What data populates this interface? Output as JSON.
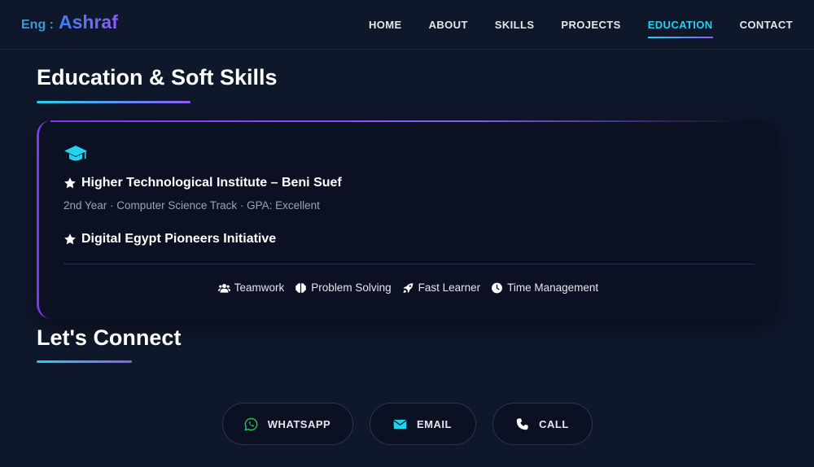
{
  "header": {
    "logo_prefix": "Eng :",
    "logo_name": "Ashraf",
    "nav": [
      {
        "label": "HOME",
        "active": false
      },
      {
        "label": "ABOUT",
        "active": false
      },
      {
        "label": "SKILLS",
        "active": false
      },
      {
        "label": "PROJECTS",
        "active": false
      },
      {
        "label": "EDUCATION",
        "active": true
      },
      {
        "label": "CONTACT",
        "active": false
      }
    ]
  },
  "education": {
    "title": "Education & Soft Skills",
    "items": [
      {
        "name": "Higher Technological Institute – Beni Suef",
        "detail": "2nd Year · Computer Science Track · GPA: Excellent"
      },
      {
        "name": "Digital Egypt Pioneers Initiative"
      }
    ],
    "soft_skills": [
      {
        "label": "Teamwork",
        "icon": "users-icon"
      },
      {
        "label": "Problem Solving",
        "icon": "brain-icon"
      },
      {
        "label": "Fast Learner",
        "icon": "rocket-icon"
      },
      {
        "label": "Time Management",
        "icon": "clock-icon"
      }
    ]
  },
  "connect": {
    "title": "Let's Connect",
    "buttons": [
      {
        "label": "WHATSAPP",
        "icon": "whatsapp-icon"
      },
      {
        "label": "EMAIL",
        "icon": "envelope-icon"
      },
      {
        "label": "CALL",
        "icon": "phone-icon"
      }
    ]
  },
  "colors": {
    "background": "#0f172a",
    "accent_cyan": "#22d3ee",
    "accent_purple": "#8b5cf6",
    "whatsapp_green": "#22c55e"
  }
}
